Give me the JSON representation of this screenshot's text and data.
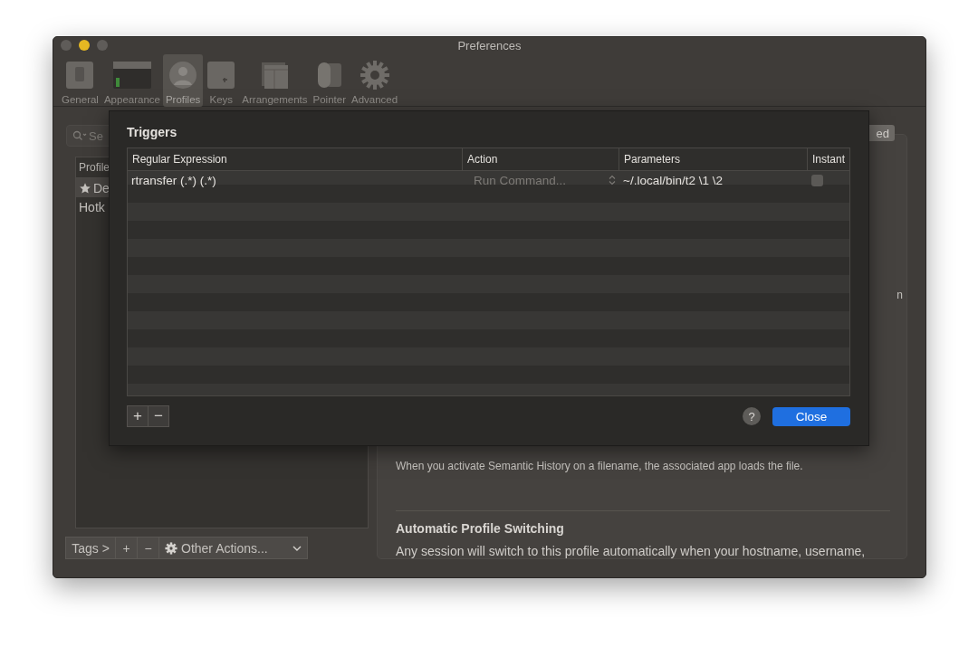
{
  "window": {
    "title": "Preferences"
  },
  "toolbar": [
    {
      "label": "General",
      "kind": "general",
      "selected": false
    },
    {
      "label": "Appearance",
      "kind": "appearance",
      "selected": false
    },
    {
      "label": "Profiles",
      "kind": "profiles",
      "selected": true
    },
    {
      "label": "Keys",
      "kind": "keys",
      "selected": false
    },
    {
      "label": "Arrangements",
      "kind": "arrangements",
      "selected": false
    },
    {
      "label": "Pointer",
      "kind": "pointer",
      "selected": false
    },
    {
      "label": "Advanced",
      "kind": "advanced",
      "selected": false
    }
  ],
  "profiles_panel": {
    "search": {
      "placeholder": "Se"
    },
    "column": "Profile",
    "rows": [
      {
        "name": "De",
        "default": true,
        "selected": true
      },
      {
        "name": "Hotk",
        "default": false,
        "selected": false
      }
    ]
  },
  "bottom_bar": {
    "tags": "Tags >",
    "add": "+",
    "remove": "−",
    "actions": "Other Actions..."
  },
  "detail": {
    "tab": "ed",
    "fragment": "n",
    "semantic_note": "When you activate Semantic History on a filename, the associated app loads the file.",
    "section_title": "Automatic Profile Switching",
    "section_text": "Any session will switch to this profile automatically when your hostname, username,"
  },
  "sheet": {
    "title": "Triggers",
    "columns": [
      "Regular Expression",
      "Action",
      "Parameters",
      "Instant"
    ],
    "rows": [
      {
        "regex": "rtransfer (.*) (.*)",
        "action": "Run Command...",
        "parameters": "~/.local/bin/t2 \\1 \\2",
        "instant": false
      }
    ],
    "add": "+",
    "remove": "−",
    "help": "?",
    "close": "Close"
  }
}
